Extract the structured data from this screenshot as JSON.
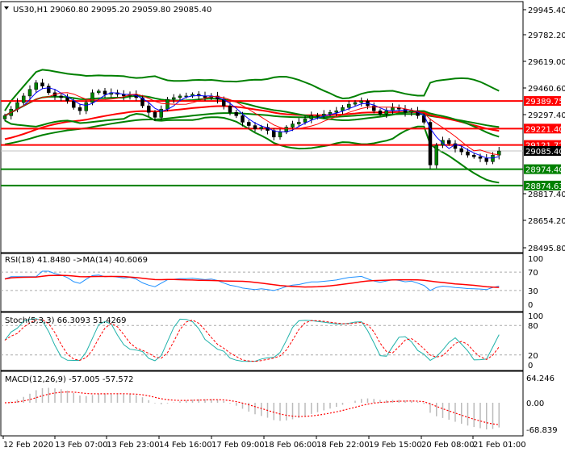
{
  "header": {
    "symbol": "US30,H1",
    "ohlc": "29060.80 29095.20 29059.80 29085.40"
  },
  "price_axis": [
    "29945.40",
    "29782.20",
    "29619.00",
    "29460.60",
    "29297.40",
    "28817.40",
    "28654.20",
    "28495.80"
  ],
  "levels": [
    {
      "label": "29389.75",
      "value": 29389.75,
      "color": "#ff0000"
    },
    {
      "label": "29221.40",
      "value": 29221.4,
      "color": "#ff0000"
    },
    {
      "label": "29121.72",
      "value": 29121.72,
      "color": "#ff0000"
    },
    {
      "label": "29085.40",
      "value": 29085.4,
      "color": "#000000"
    },
    {
      "label": "28974.40",
      "value": 28974.4,
      "color": "#008000"
    },
    {
      "label": "28874.63",
      "value": 28874.63,
      "color": "#008000"
    }
  ],
  "rsi": {
    "title": "RSI(18) 41.8480  ->MA(14) 40.6069",
    "axis": [
      "100",
      "70",
      "30",
      "0"
    ]
  },
  "stoch": {
    "title": "Stoch(5,3,3) 66.3093 51.4269",
    "axis": [
      "100",
      "80",
      "20",
      "0"
    ]
  },
  "macd": {
    "title": "MACD(12,26,9) -57.005 -57.572",
    "axis": [
      "64.246",
      "0.00",
      "-68.839"
    ]
  },
  "time_axis": [
    "12 Feb 2020",
    "13 Feb 07:00",
    "13 Feb 23:00",
    "14 Feb 16:00",
    "17 Feb 09:00",
    "18 Feb 06:00",
    "18 Feb 22:00",
    "19 Feb 15:00",
    "20 Feb 08:00",
    "21 Feb 01:00"
  ],
  "colors": {
    "bull": "#008000",
    "bear": "#ff0000",
    "band": "#008000",
    "rsi": "#1e90ff",
    "signal": "#ff0000",
    "stoch": "#20b2aa"
  },
  "chart_data": {
    "type": "candlestick",
    "closes": [
      29300,
      29340,
      29380,
      29420,
      29460,
      29500,
      29480,
      29440,
      29420,
      29410,
      29390,
      29350,
      29330,
      29380,
      29440,
      29450,
      29430,
      29440,
      29430,
      29420,
      29430,
      29410,
      29360,
      29320,
      29290,
      29340,
      29400,
      29410,
      29420,
      29420,
      29430,
      29420,
      29410,
      29420,
      29400,
      29360,
      29320,
      29300,
      29260,
      29240,
      29220,
      29230,
      29210,
      29170,
      29200,
      29230,
      29250,
      29260,
      29280,
      29300,
      29300,
      29310,
      29320,
      29330,
      29350,
      29370,
      29380,
      29390,
      29360,
      29330,
      29310,
      29330,
      29350,
      29340,
      29320,
      29330,
      29300,
      29260,
      29000,
      29120,
      29150,
      29130,
      29100,
      29080,
      29060,
      29050,
      29040,
      29020,
      29060,
      29085
    ],
    "ylim": [
      28495.8,
      29945.4
    ]
  }
}
